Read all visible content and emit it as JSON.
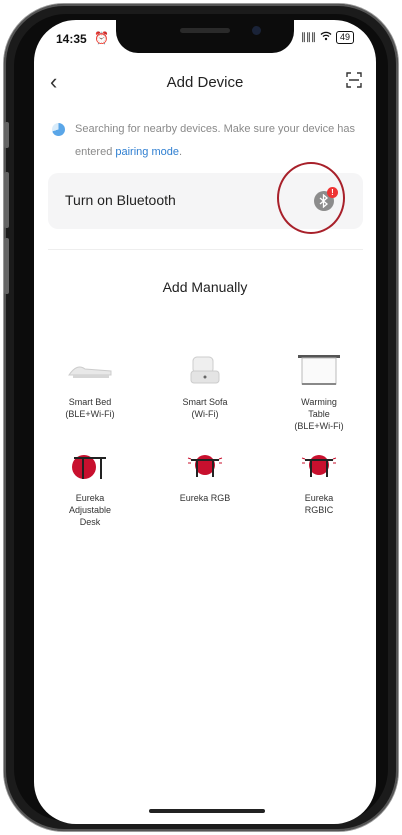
{
  "status_bar": {
    "time": "14:35",
    "alarm_icon": "alarm-icon",
    "signal": "∥∥∥",
    "wifi": "wifi-icon",
    "battery": "49"
  },
  "header": {
    "back_glyph": "‹",
    "title": "Add Device",
    "scan_icon": "scan-icon"
  },
  "search_notice": {
    "text": "Searching for nearby devices. Make sure your device has entered ",
    "link": "pairing mode",
    "suffix": "."
  },
  "bluetooth": {
    "label": "Turn on Bluetooth",
    "badge": "!"
  },
  "manual": {
    "title": "Add Manually",
    "devices": [
      {
        "label": "Smart Bed\n(BLE+Wi-Fi)",
        "icon": "smart-bed-icon"
      },
      {
        "label": "Smart Sofa\n(Wi-Fi)",
        "icon": "smart-sofa-icon"
      },
      {
        "label": "Warming\nTable\n(BLE+Wi-Fi)",
        "icon": "warming-table-icon"
      },
      {
        "label": "Eureka\nAdjustable\nDesk",
        "icon": "adjustable-desk-icon"
      },
      {
        "label": "Eureka RGB",
        "icon": "rgb-desk-icon"
      },
      {
        "label": "Eureka\nRGBIC",
        "icon": "rgbic-desk-icon"
      }
    ]
  },
  "colors": {
    "accent": "#2f7fd1",
    "desk_red": "#c8102e",
    "highlight": "#a8202a"
  }
}
